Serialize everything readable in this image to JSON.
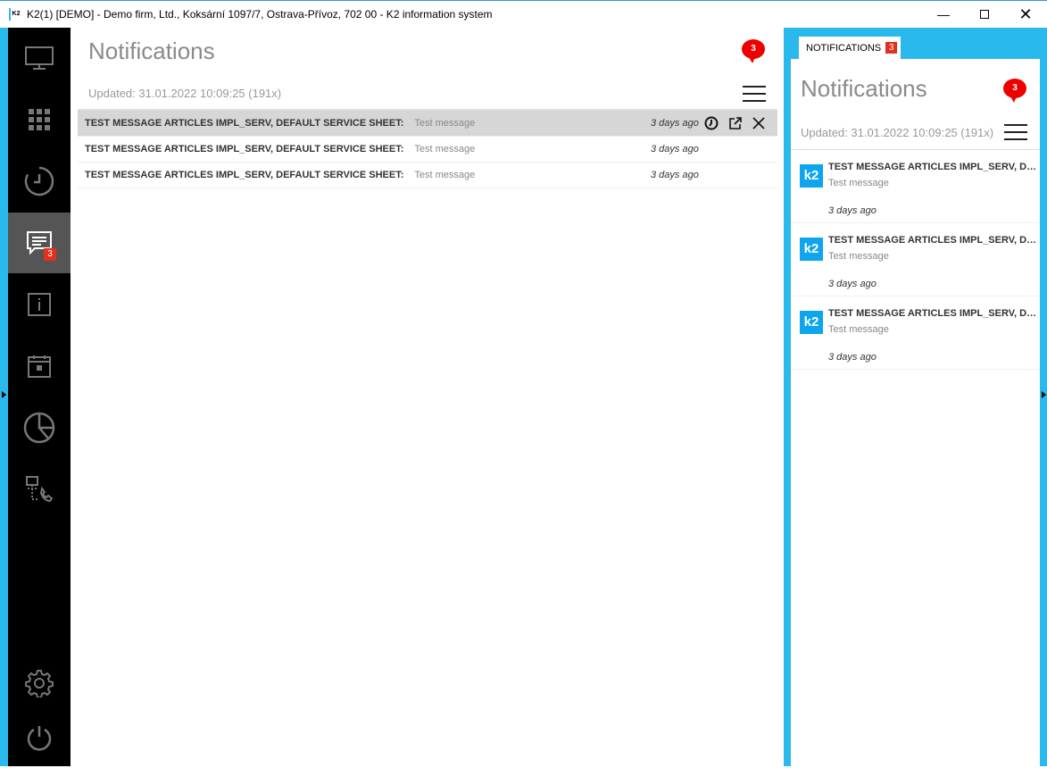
{
  "window": {
    "title": "K2(1) [DEMO] - Demo firm, Ltd., Koksární 1097/7, Ostrava-Přívoz, 702 00 - K2 information system",
    "logo": "K2"
  },
  "sidebar": {
    "items": [
      {
        "icon": "monitor-icon"
      },
      {
        "icon": "apps-grid-icon"
      },
      {
        "icon": "history-icon"
      },
      {
        "icon": "notifications-icon",
        "badge": "3",
        "active": true
      },
      {
        "icon": "info-icon"
      },
      {
        "icon": "calendar-icon"
      },
      {
        "icon": "pie-chart-icon"
      },
      {
        "icon": "network-phone-icon"
      },
      {
        "icon": "gear-icon"
      },
      {
        "icon": "power-icon"
      }
    ]
  },
  "main": {
    "title": "Notifications",
    "badge": "3",
    "updated": "Updated: 31.01.2022 10:09:25 (191x)",
    "rows": [
      {
        "title": "TEST MESSAGE ARTICLES IMPL_SERV, DEFAULT SERVICE SHEET:",
        "message": "Test message",
        "time": "3 days ago"
      },
      {
        "title": "TEST MESSAGE ARTICLES IMPL_SERV, DEFAULT SERVICE SHEET:",
        "message": "Test message",
        "time": "3 days ago"
      },
      {
        "title": "TEST MESSAGE ARTICLES IMPL_SERV, DEFAULT SERVICE SHEET:",
        "message": "Test message",
        "time": "3 days ago"
      }
    ]
  },
  "panel": {
    "tab_label": "NOTIFICATIONS",
    "tab_badge": "3",
    "title": "Notifications",
    "badge": "3",
    "updated": "Updated: 31.01.2022 10:09:25 (191x)",
    "cards": [
      {
        "logo": "k2",
        "title": "TEST MESSAGE ARTICLES IMPL_SERV, DEFAULT SERVICE SHEET:",
        "message": "Test message",
        "time": "3 days ago"
      },
      {
        "logo": "k2",
        "title": "TEST MESSAGE ARTICLES IMPL_SERV, DEFAULT SERVICE SHEET:",
        "message": "Test message",
        "time": "3 days ago"
      },
      {
        "logo": "k2",
        "title": "TEST MESSAGE ARTICLES IMPL_SERV, DEFAULT SERVICE SHEET:",
        "message": "Test message",
        "time": "3 days ago"
      }
    ]
  },
  "colors": {
    "accent": "#29b9ed",
    "sidebar": "#000000",
    "badge": "#e0301e",
    "bubble": "#ee0000",
    "k2": "#0ea5ef"
  }
}
